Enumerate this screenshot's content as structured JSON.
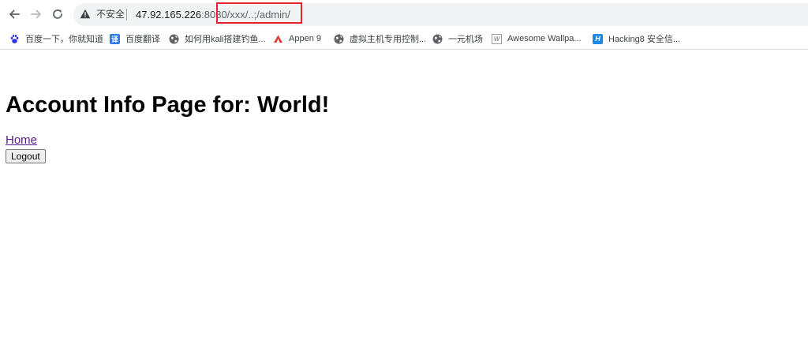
{
  "browser": {
    "security_label": "不安全",
    "url_host": "47.92.165.226",
    "url_rest": ":8080/xxx/..;/admin/"
  },
  "bookmarks": [
    {
      "label": "百度一下，你就知道",
      "icon": "baidu-paw-icon",
      "color": "#2932e1"
    },
    {
      "label": "百度翻译",
      "icon": "baidu-translate-icon",
      "color": "#2b7bf0"
    },
    {
      "label": "如何用kali搭建钓鱼...",
      "icon": "globe-icon",
      "color": "#5f6368"
    },
    {
      "label": "Appen 9",
      "icon": "appen-icon",
      "color": "#e8372f"
    },
    {
      "label": "虚拟主机专用控制...",
      "icon": "globe-icon",
      "color": "#5f6368"
    },
    {
      "label": "一元机场",
      "icon": "globe-icon",
      "color": "#5f6368"
    },
    {
      "label": "Awesome Wallpa...",
      "icon": "wallpaper-icon",
      "color": "#8a8a8a"
    },
    {
      "label": "Hacking8 安全信...",
      "icon": "hacking8-icon",
      "color": "#1e88e5"
    }
  ],
  "page": {
    "title": "Account Info Page for: World!",
    "home_link": "Home",
    "logout_label": "Logout"
  },
  "colors": {
    "highlight": "#e8232f",
    "visited_link": "#551a8b"
  }
}
